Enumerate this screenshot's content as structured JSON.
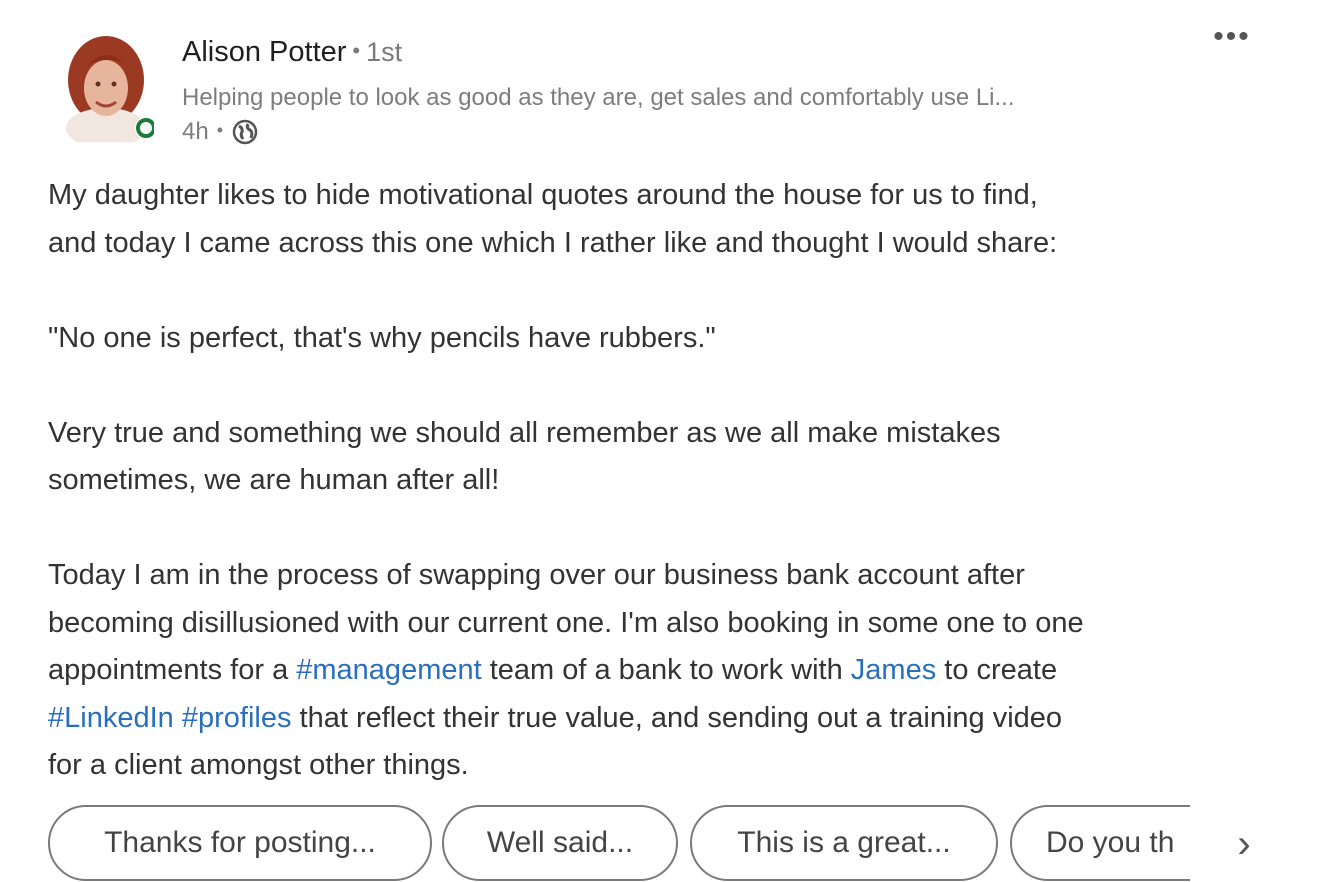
{
  "author": {
    "name": "Alison Potter",
    "separator": "•",
    "degree": "1st",
    "headline": "Helping people to look as good as they are, get sales and comfortably use Li...",
    "time": "4h",
    "meta_separator": "•",
    "visibility_icon": "globe-icon",
    "avatar_icon": "profile-photo",
    "status_color": "#1b7a3c"
  },
  "menu": {
    "more_label": "•••"
  },
  "post": {
    "paragraphs": [
      [
        "My daughter likes to hide motivational quotes around the house for us to find,",
        "and today I came across this one which I rather like and thought I would share:"
      ],
      [
        "\"No one is perfect, that's why pencils have rubbers.\""
      ],
      [
        "Very true and something we should all remember as we all make mistakes",
        "sometimes, we are human after all!"
      ]
    ],
    "last_paragraph": {
      "line1": "Today I am in the process of swapping over our business bank account after",
      "line2": "becoming disillusioned with our current one. I'm also booking in some one to one",
      "line3_a": "appointments for a ",
      "hashtag_management": "#management",
      "line3_b": " team of a bank to work with ",
      "mention_james": "James",
      "line3_c": " to create",
      "hashtag_linkedin": "#LinkedIn",
      "line4_space": " ",
      "hashtag_profiles": "#profiles",
      "line4_b": " that reflect their true value, and sending out a training video",
      "line5": "for a client amongst other things."
    },
    "link_color": "#2a6fbd"
  },
  "suggestions": {
    "chips": [
      "Thanks for posting...",
      "Well said...",
      "This is a great...",
      "Do you th"
    ],
    "next_icon": "chevron-right-icon",
    "next_label": "›"
  }
}
